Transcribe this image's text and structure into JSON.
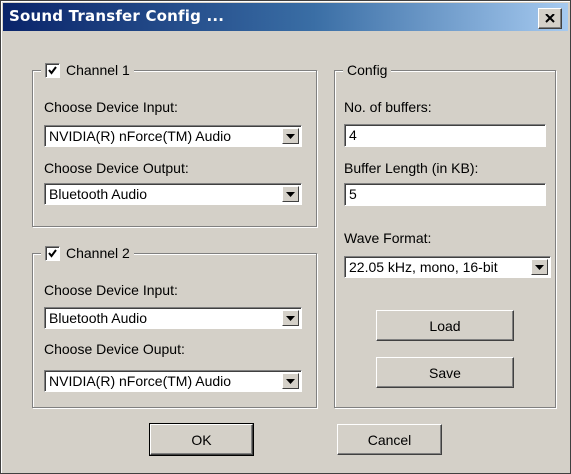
{
  "window": {
    "title": "Sound Transfer Config ..."
  },
  "channel1": {
    "label": "Channel 1",
    "checked": true,
    "input_label": "Choose Device Input:",
    "input_value": "NVIDIA(R) nForce(TM) Audio",
    "output_label": "Choose Device Output:",
    "output_value": "Bluetooth Audio"
  },
  "channel2": {
    "label": "Channel 2",
    "checked": true,
    "input_label": "Choose Device Input:",
    "input_value": "Bluetooth Audio",
    "output_label": "Choose Device Ouput:",
    "output_value": "NVIDIA(R) nForce(TM) Audio"
  },
  "config": {
    "label": "Config",
    "buffers_label": "No. of buffers:",
    "buffers_value": "4",
    "buffer_length_label": "Buffer Length (in KB):",
    "buffer_length_value": "5",
    "wave_format_label": "Wave Format:",
    "wave_format_value": "22.05 kHz, mono, 16-bit",
    "load_label": "Load",
    "save_label": "Save"
  },
  "buttons": {
    "ok_label": "OK",
    "cancel_label": "Cancel"
  }
}
